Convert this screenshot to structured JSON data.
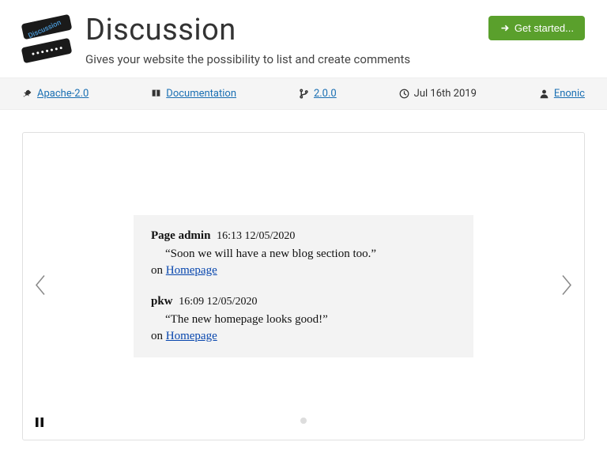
{
  "header": {
    "title": "Discussion",
    "subtitle": "Gives your website the possibility to list and create comments",
    "logo_label": "Discussion",
    "get_started_label": "Get started..."
  },
  "meta": {
    "license": "Apache-2.0",
    "documentation": "Documentation",
    "version": "2.0.0",
    "date": "Jul 16th 2019",
    "author": "Enonic"
  },
  "carousel": {
    "comments": [
      {
        "author": "Page admin",
        "time": "16:13 12/05/2020",
        "body": "“Soon we will have a new blog section too.”",
        "on_prefix": "on ",
        "page": "Homepage"
      },
      {
        "author": "pkw",
        "time": "16:09 12/05/2020",
        "body": "“The new homepage looks good!”",
        "on_prefix": "on ",
        "page": "Homepage"
      }
    ]
  }
}
